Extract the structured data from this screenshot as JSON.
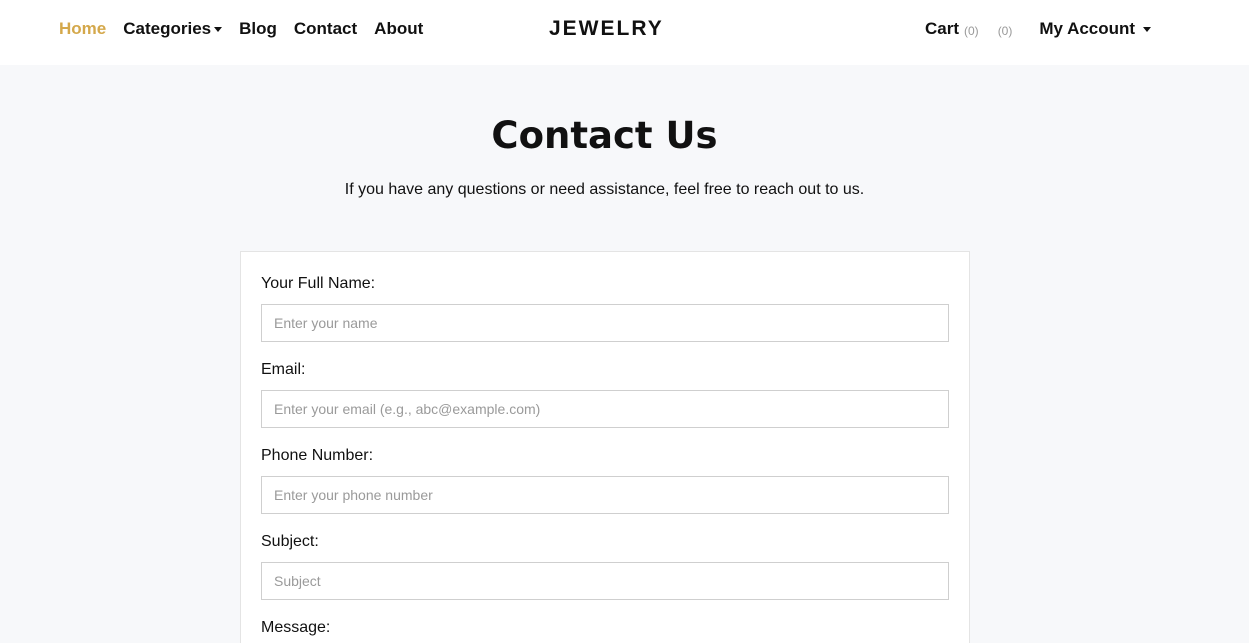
{
  "nav": {
    "links": [
      "Home",
      "Categories",
      "Blog",
      "Contact",
      "About"
    ],
    "brand": "JEWELRY",
    "cart_label": "Cart",
    "cart_count": "(0)",
    "wishlist_count": "(0)",
    "account_label": "My Account"
  },
  "page": {
    "title": "Contact Us",
    "subtitle": "If you have any questions or need assistance, feel free to reach out to us."
  },
  "form": {
    "name_label": "Your Full Name:",
    "name_placeholder": "Enter your name",
    "email_label": "Email:",
    "email_placeholder": "Enter your email (e.g., abc@example.com)",
    "phone_label": "Phone Number:",
    "phone_placeholder": "Enter your phone number",
    "subject_label": "Subject:",
    "subject_placeholder": "Subject",
    "message_label": "Message:"
  },
  "colors": {
    "accent": "#d4a84b",
    "background": "#f7f8fa"
  }
}
